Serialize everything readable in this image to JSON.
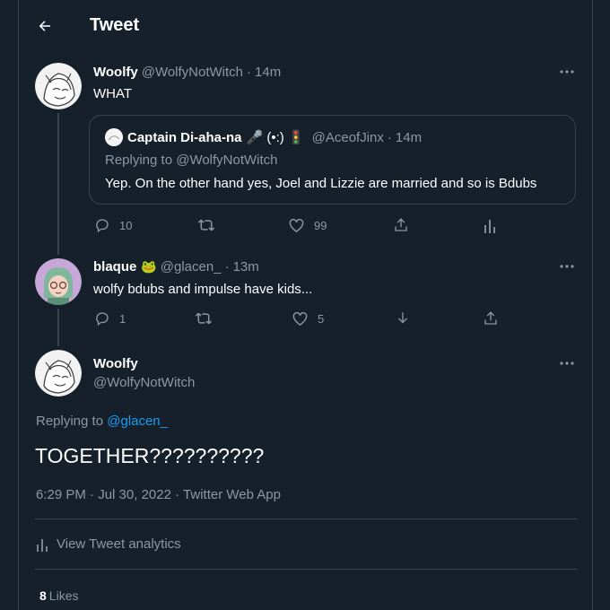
{
  "header": {
    "title": "Tweet"
  },
  "tweet1": {
    "name": "Woolfy",
    "handle": "@WolfyNotWitch",
    "time": "14m",
    "text": "WHAT",
    "quote": {
      "name": "Captain Di-aha-na",
      "name_emoji": "🎤 (•:) 🚦",
      "handle": "@AceofJinx",
      "time": "14m",
      "replying": "Replying to @WolfyNotWitch",
      "text": "Yep. On the other hand yes, Joel and Lizzie are married and so is Bdubs"
    },
    "actions": {
      "replies": "10",
      "likes": "99"
    }
  },
  "tweet2": {
    "name": "blaque",
    "handle": "@glacen_",
    "time": "13m",
    "text": "wolfy bdubs and impulse have kids...",
    "actions": {
      "replies": "1",
      "likes": "5"
    }
  },
  "main": {
    "name": "Woolfy",
    "handle": "@WolfyNotWitch",
    "replying_prefix": "Replying to ",
    "replying_link": "@glacen_",
    "text": "TOGETHER??????????",
    "meta": {
      "time": "6:29 PM",
      "date": "Jul 30, 2022",
      "source": "Twitter Web App"
    },
    "analytics_label": "View Tweet analytics",
    "likes_count": "8",
    "likes_label": "Likes"
  },
  "colors": {
    "background": "#15202b",
    "border": "#38444d",
    "secondary_text": "#8b98a5",
    "link": "#1d9bf0"
  },
  "icons": [
    "back-arrow-icon",
    "more-icon",
    "reply-icon",
    "retweet-icon",
    "like-icon",
    "share-icon",
    "analytics-icon",
    "frog-emoji-icon",
    "download-icon"
  ]
}
